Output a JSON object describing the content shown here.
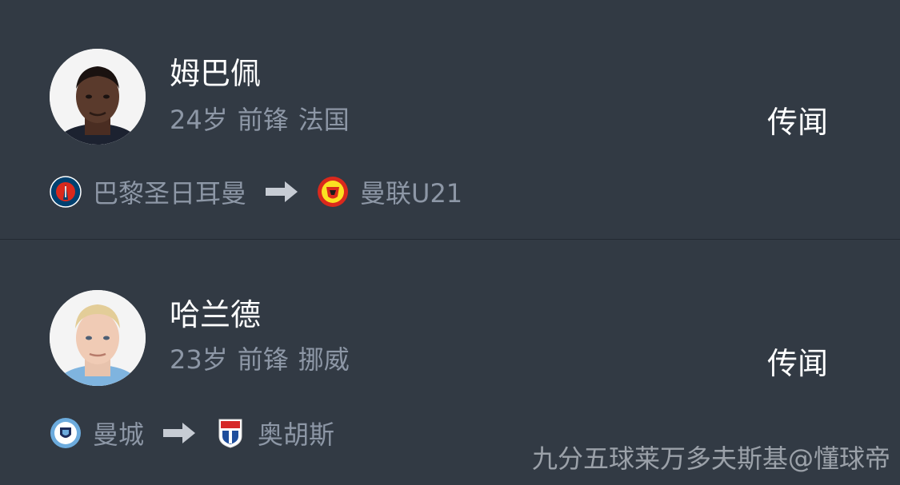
{
  "players": [
    {
      "name": "姆巴佩",
      "age": "24岁",
      "position": "前锋",
      "nation": "法国",
      "tag": "传闻",
      "from_club": "巴黎圣日耳曼",
      "from_club_icon": "psg-crest-icon",
      "to_club": "曼联U21",
      "to_club_icon": "manchester-united-crest-icon"
    },
    {
      "name": "哈兰德",
      "age": "23岁",
      "position": "前锋",
      "nation": "挪威",
      "tag": "传闻",
      "from_club": "曼城",
      "from_club_icon": "manchester-city-crest-icon",
      "to_club": "奥胡斯",
      "to_club_icon": "aarhus-crest-icon"
    }
  ],
  "watermark": "九分五球莱万多夫斯基@懂球帝",
  "colors": {
    "background": "#323a44",
    "primary_text": "#ffffff",
    "secondary_text": "#8d97a6",
    "divider": "#232a32"
  }
}
